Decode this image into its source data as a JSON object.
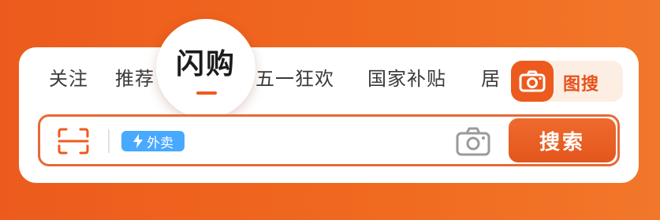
{
  "tabs": {
    "items": [
      {
        "label": "关注"
      },
      {
        "label": "推荐"
      },
      {
        "label": "闪购"
      },
      {
        "label": "五一狂欢"
      },
      {
        "label": "国家补贴"
      },
      {
        "label": "居"
      }
    ]
  },
  "image_search": {
    "label": "图搜",
    "icon": "camera-icon"
  },
  "search": {
    "badge_label": "外卖",
    "badge_icon": "lightning-icon",
    "button_label": "搜索",
    "scan_icon": "scan-icon",
    "camera_icon": "camera-icon"
  },
  "colors": {
    "brand": "#ec5b1d",
    "badge_blue": "#47a9ff",
    "image_search_bg": "#fdeee4"
  }
}
